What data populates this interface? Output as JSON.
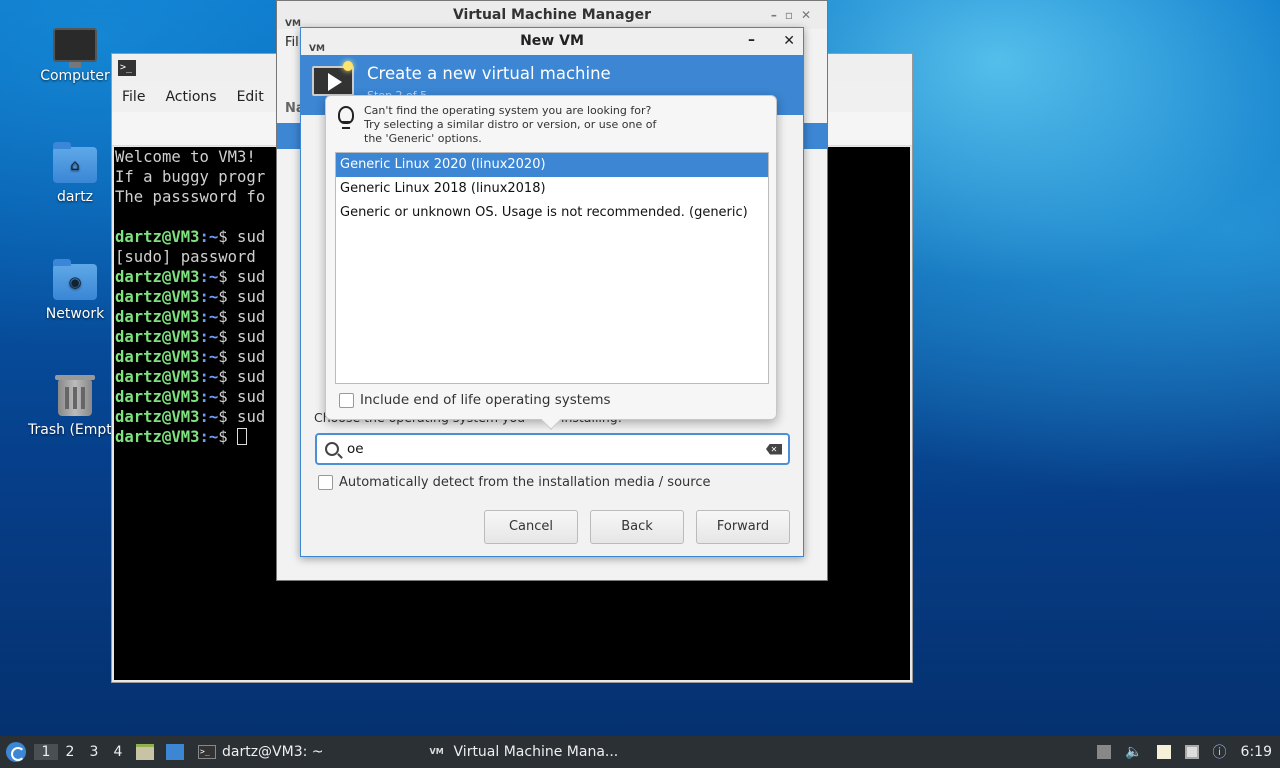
{
  "desktop": {
    "icons": [
      {
        "label": "Computer"
      },
      {
        "label": "dartz"
      },
      {
        "label": "Network"
      },
      {
        "label": "Trash (Empty)"
      }
    ]
  },
  "terminal": {
    "menu": [
      "File",
      "Actions",
      "Edit"
    ],
    "lines": [
      {
        "text": "Welcome to VM3!"
      },
      {
        "text": "If a buggy progr"
      },
      {
        "text": "The passsword fo"
      },
      {
        "text": ""
      },
      {
        "user": "dartz@VM3",
        "path": ":~",
        "cmd": "$ sud"
      },
      {
        "text": "[sudo] password "
      },
      {
        "user": "dartz@VM3",
        "path": ":~",
        "cmd": "$ sud"
      },
      {
        "user": "dartz@VM3",
        "path": ":~",
        "cmd": "$ sud"
      },
      {
        "user": "dartz@VM3",
        "path": ":~",
        "cmd": "$ sud"
      },
      {
        "user": "dartz@VM3",
        "path": ":~",
        "cmd": "$ sud"
      },
      {
        "user": "dartz@VM3",
        "path": ":~",
        "cmd": "$ sud"
      },
      {
        "user": "dartz@VM3",
        "path": ":~",
        "cmd": "$ sud"
      },
      {
        "user": "dartz@VM3",
        "path": ":~",
        "cmd": "$ sud"
      },
      {
        "user": "dartz@VM3",
        "path": ":~",
        "cmd": "$ sud"
      },
      {
        "user": "dartz@VM3",
        "path": ":~",
        "cmd": "$ ",
        "cursor": true
      }
    ]
  },
  "vmm": {
    "title": "Virtual Machine Manager",
    "logo": "VM",
    "menu_fragment": "Fil",
    "name_fragment": "Na"
  },
  "new_vm": {
    "title": "New VM",
    "logo": "VM",
    "header_title": "Create a new virtual machine",
    "header_step": "Step 2 of 5",
    "choose_label_left": "Choose the operating system you",
    "choose_label_right": "installing:",
    "search_value": "oe",
    "auto_detect_label": "Automatically detect from the installation media / source",
    "buttons": {
      "cancel": "Cancel",
      "back": "Back",
      "forward": "Forward"
    }
  },
  "os_popover": {
    "hint_lines": [
      "Can't find the operating system you are looking for?",
      "Try selecting a similar distro or version, or use one of",
      "the 'Generic' options."
    ],
    "os_items": [
      {
        "label": "Generic Linux 2020 (linux2020)",
        "selected": true
      },
      {
        "label": "Generic Linux 2018 (linux2018)",
        "selected": false
      },
      {
        "label": "Generic or unknown OS. Usage is not recommended. (generic)",
        "selected": false
      }
    ],
    "eol_label": "Include end of life operating systems"
  },
  "taskbar": {
    "workspaces": [
      "1",
      "2",
      "3",
      "4"
    ],
    "active_workspace": "1",
    "tasks": [
      {
        "label": "dartz@VM3: ~"
      },
      {
        "label": "Virtual Machine Mana..."
      }
    ],
    "clock": "6:19"
  },
  "colors": {
    "accent": "#3c86d4",
    "terminal_bg": "#000000",
    "prompt_user": "#7ee27e",
    "prompt_path": "#6ca0ff"
  }
}
